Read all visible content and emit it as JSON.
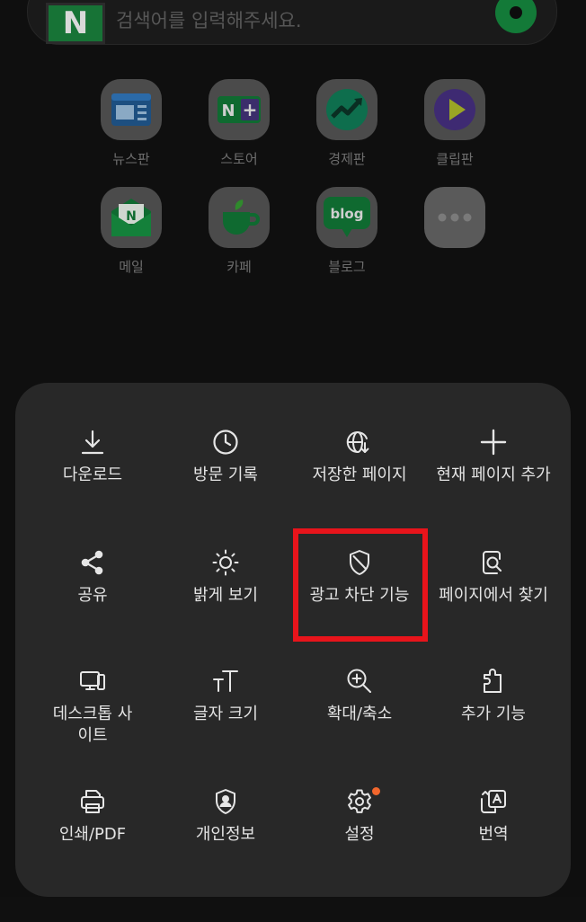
{
  "search": {
    "logo": "N",
    "placeholder": "검색어를 입력해주세요."
  },
  "shortcuts": [
    {
      "label": "뉴스판",
      "icon": "news-icon"
    },
    {
      "label": "스토어",
      "icon": "store-icon"
    },
    {
      "label": "경제판",
      "icon": "finance-icon"
    },
    {
      "label": "클립판",
      "icon": "clip-icon"
    },
    {
      "label": "메일",
      "icon": "mail-icon"
    },
    {
      "label": "카페",
      "icon": "cafe-icon"
    },
    {
      "label": "블로그",
      "icon": "blog-icon",
      "text": "blog"
    },
    {
      "label": "",
      "icon": "more-icon"
    }
  ],
  "menu": {
    "items": [
      {
        "label": "다운로드",
        "icon": "download-icon"
      },
      {
        "label": "방문 기록",
        "icon": "history-icon"
      },
      {
        "label": "저장한 페이지",
        "icon": "saved-page-icon"
      },
      {
        "label": "현재 페이지 추가",
        "icon": "add-icon"
      },
      {
        "label": "공유",
        "icon": "share-icon"
      },
      {
        "label": "밝게 보기",
        "icon": "brightness-icon"
      },
      {
        "label": "광고 차단 기능",
        "icon": "ad-block-shield-icon"
      },
      {
        "label": "페이지에서 찾기",
        "icon": "find-in-page-icon"
      },
      {
        "label": "데스크톱 사이트",
        "icon": "desktop-site-icon"
      },
      {
        "label": "글자 크기",
        "icon": "text-size-icon"
      },
      {
        "label": "확대/축소",
        "icon": "zoom-icon"
      },
      {
        "label": "추가 기능",
        "icon": "extensions-icon"
      },
      {
        "label": "인쇄/PDF",
        "icon": "print-icon"
      },
      {
        "label": "개인정보",
        "icon": "privacy-icon"
      },
      {
        "label": "설정",
        "icon": "settings-icon",
        "badge": true
      },
      {
        "label": "번역",
        "icon": "translate-icon"
      }
    ]
  },
  "colors": {
    "sheet_background": "#282828",
    "page_background": "#0f0f0f",
    "highlight": "#e8141b",
    "badge": "#f2672d",
    "naver_green": "#177336"
  }
}
